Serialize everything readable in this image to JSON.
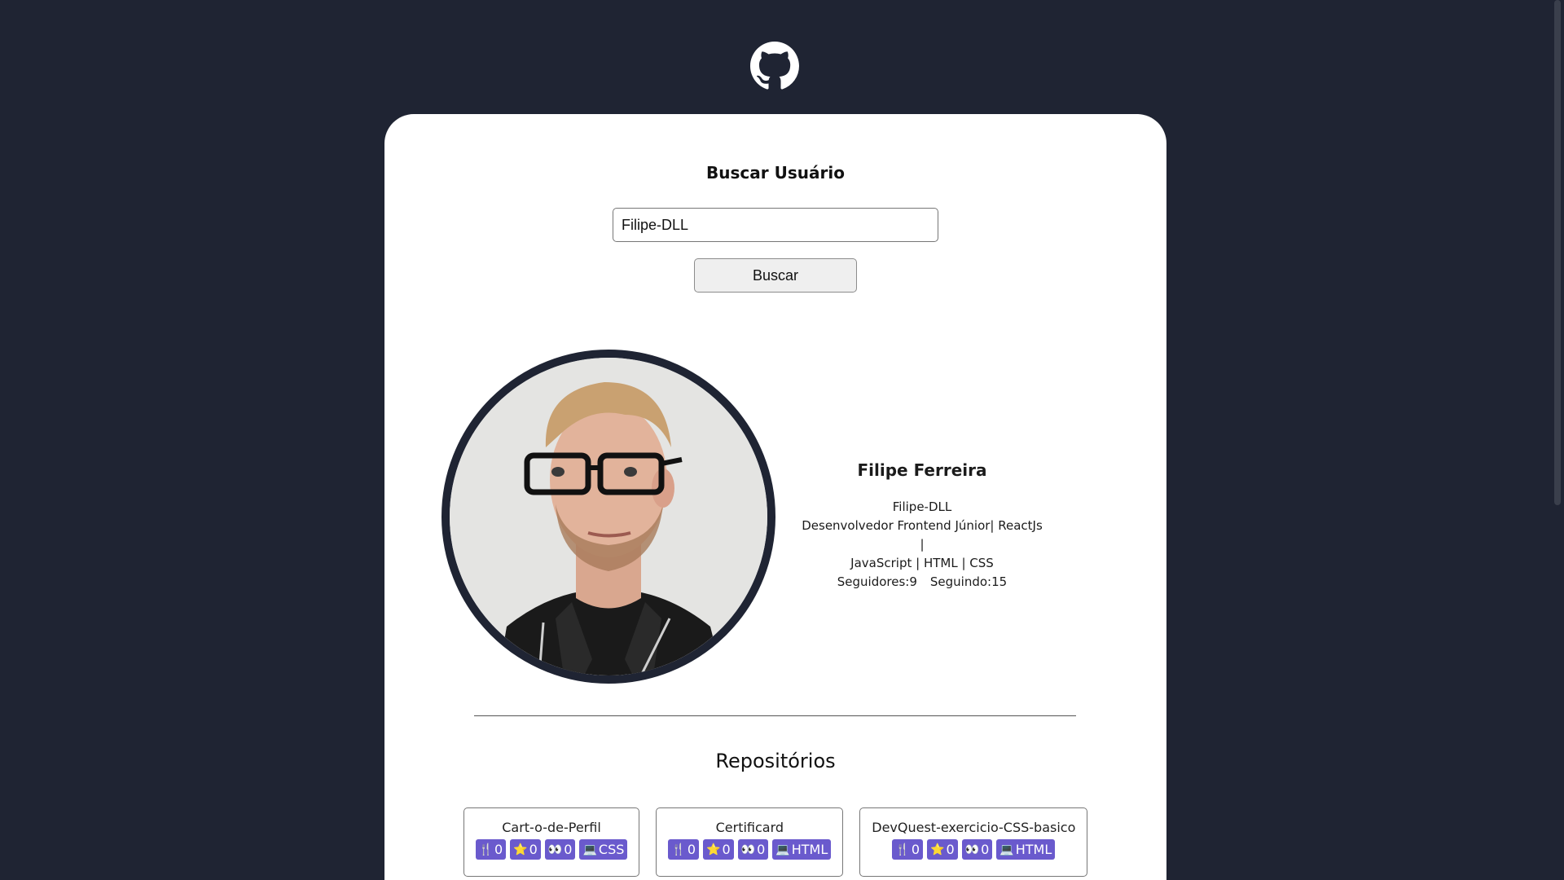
{
  "logo": {
    "icon": "github-logo-icon"
  },
  "search": {
    "title": "Buscar Usuário",
    "input_value": "Filipe-DLL",
    "button_label": "Buscar"
  },
  "profile": {
    "name": "Filipe Ferreira",
    "username": "Filipe-DLL",
    "bio_line1": "Desenvolvedor Frontend Júnior| ReactJs |",
    "bio_line2": "JavaScript | HTML | CSS",
    "followers": "Seguidores:9",
    "following": "Seguindo:15"
  },
  "repositories": {
    "title": "Repositórios",
    "items": [
      {
        "name": "Cart-o-de-Perfil",
        "forks": "0",
        "stars": "0",
        "watchers": "0",
        "language": "CSS"
      },
      {
        "name": "Certificard",
        "forks": "0",
        "stars": "0",
        "watchers": "0",
        "language": "HTML"
      },
      {
        "name": "DevQuest-exercicio-CSS-basico",
        "forks": "0",
        "stars": "0",
        "watchers": "0",
        "language": "HTML"
      }
    ]
  },
  "colors": {
    "background": "#1f2433",
    "card": "#ffffff",
    "badge": "#6a5acd"
  }
}
